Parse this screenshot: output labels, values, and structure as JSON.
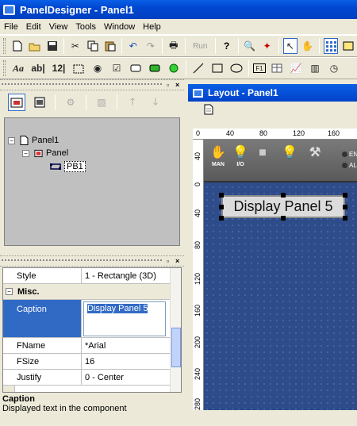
{
  "app": {
    "title": "PanelDesigner - Panel1"
  },
  "menu": [
    "File",
    "Edit",
    "View",
    "Tools",
    "Window",
    "Help"
  ],
  "toolbar1": {
    "run_label": "Run"
  },
  "toolbar2": {
    "font_label": "Aa",
    "text_label": "ab|",
    "number_label": "12|",
    "f1_label": "F1"
  },
  "tree": {
    "nodes": [
      {
        "label": "Panel1",
        "toggle": "−"
      },
      {
        "label": "Panel",
        "toggle": "−"
      },
      {
        "label": "PB1"
      }
    ]
  },
  "properties": {
    "rows": [
      {
        "name": "Style",
        "value": "1 - Rectangle (3D)"
      },
      {
        "category": "Misc.",
        "toggle": "−"
      },
      {
        "name": "Caption",
        "value": "Display Panel 5"
      },
      {
        "name": "FName",
        "value": "*Arial"
      },
      {
        "name": "FSize",
        "value": "16"
      },
      {
        "name": "Justify",
        "value": "0 - Center"
      }
    ],
    "description_title": "Caption",
    "description_text": "Displayed text in the component"
  },
  "layout": {
    "title": "Layout - Panel1",
    "hruler_ticks": [
      "0",
      "40",
      "80",
      "120",
      "160"
    ],
    "vruler_ticks": [
      "40",
      "0",
      "40",
      "80",
      "120",
      "160",
      "200",
      "240",
      "280"
    ],
    "device_icons": [
      {
        "label": "MAN",
        "icon": "hand-icon"
      },
      {
        "label": "I/O",
        "icon": "bulb-icon"
      },
      {
        "label": "",
        "icon": "square-icon"
      },
      {
        "label": "",
        "icon": "bulb-icon"
      },
      {
        "label": "",
        "icon": "wrench-icon"
      }
    ],
    "side_labels": [
      "EN",
      "AL"
    ],
    "display_text": "Display Panel 5"
  }
}
